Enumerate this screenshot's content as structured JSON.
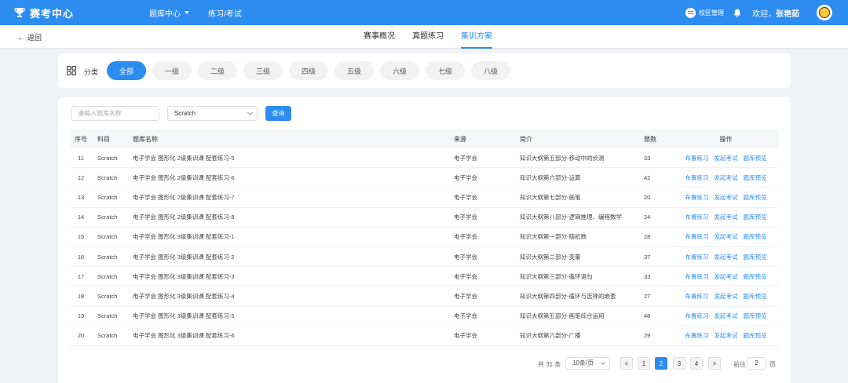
{
  "header": {
    "brand": "赛考中心",
    "nav": [
      {
        "label": "题库中心"
      },
      {
        "label": "练习/考试"
      }
    ],
    "campus": "校区管理",
    "welcome_prefix": "欢迎，",
    "user_name": "张艳茹"
  },
  "subnav": {
    "back": "返回",
    "tabs": [
      {
        "label": "赛事概况"
      },
      {
        "label": "真题练习"
      },
      {
        "label": "集训方案"
      }
    ]
  },
  "category": {
    "label": "分类",
    "options": [
      "全部",
      "一级",
      "二级",
      "三级",
      "四级",
      "五级",
      "六级",
      "七级",
      "八级"
    ]
  },
  "filter": {
    "search_placeholder": "请输入题库名称",
    "subject": "Scratch",
    "query": "查询"
  },
  "table": {
    "headers": {
      "no": "序号",
      "subject": "科目",
      "name": "题库名称",
      "source": "来源",
      "intro": "简介",
      "count": "题数",
      "ops": "操作"
    },
    "ops": [
      "布置练习",
      "发起考试",
      "题库预览"
    ],
    "rows": [
      {
        "no": "11",
        "subject": "Scratch",
        "name": "电子学会 图形化 2级集训课 配套练习-5",
        "source": "电子学会",
        "intro": "知识大纲第五部分-移动中的侦测",
        "count": "33"
      },
      {
        "no": "12",
        "subject": "Scratch",
        "name": "电子学会 图形化 2级集训课 配套练习-6",
        "source": "电子学会",
        "intro": "知识大纲第六部分-运算",
        "count": "42"
      },
      {
        "no": "13",
        "subject": "Scratch",
        "name": "电子学会 图形化 2级集训课 配套练习-7",
        "source": "电子学会",
        "intro": "知识大纲第七部分-画笔",
        "count": "20"
      },
      {
        "no": "14",
        "subject": "Scratch",
        "name": "电子学会 图形化 2级集训课 配套练习-8",
        "source": "电子学会",
        "intro": "知识大纲第八部分-逻辑推理、编程数学",
        "count": "24"
      },
      {
        "no": "15",
        "subject": "Scratch",
        "name": "电子学会 图形化 3级集训课 配套练习-1",
        "source": "电子学会",
        "intro": "知识大纲第一部分-随机数",
        "count": "28"
      },
      {
        "no": "16",
        "subject": "Scratch",
        "name": "电子学会 图形化 3级集训课 配套练习-2",
        "source": "电子学会",
        "intro": "知识大纲第二部分-变量",
        "count": "37"
      },
      {
        "no": "17",
        "subject": "Scratch",
        "name": "电子学会 图形化 3级集训课 配套练习-3",
        "source": "电子学会",
        "intro": "知识大纲第三部分-循环语句",
        "count": "33"
      },
      {
        "no": "18",
        "subject": "Scratch",
        "name": "电子学会 图形化 3级集训课 配套练习-4",
        "source": "电子学会",
        "intro": "知识大纲第四部分-循环与选择的嵌套",
        "count": "27"
      },
      {
        "no": "19",
        "subject": "Scratch",
        "name": "电子学会 图形化 3级集训课 配套练习-5",
        "source": "电子学会",
        "intro": "知识大纲第五部分-画笔综合运用",
        "count": "48"
      },
      {
        "no": "20",
        "subject": "Scratch",
        "name": "电子学会 图形化 3级集训课 配套练习-6",
        "source": "电子学会",
        "intro": "知识大纲第六部分-广播",
        "count": "29"
      }
    ]
  },
  "pagination": {
    "total": "共 31 条",
    "page_size": "10条/页",
    "pages": [
      "1",
      "2",
      "3",
      "4"
    ],
    "current": "2",
    "prev": "<",
    "next": ">",
    "jump_prefix": "前往",
    "jump_value": "2",
    "jump_suffix": "页"
  },
  "colors": {
    "primary": "#2d8cf0",
    "background": "#f0f2f5"
  }
}
